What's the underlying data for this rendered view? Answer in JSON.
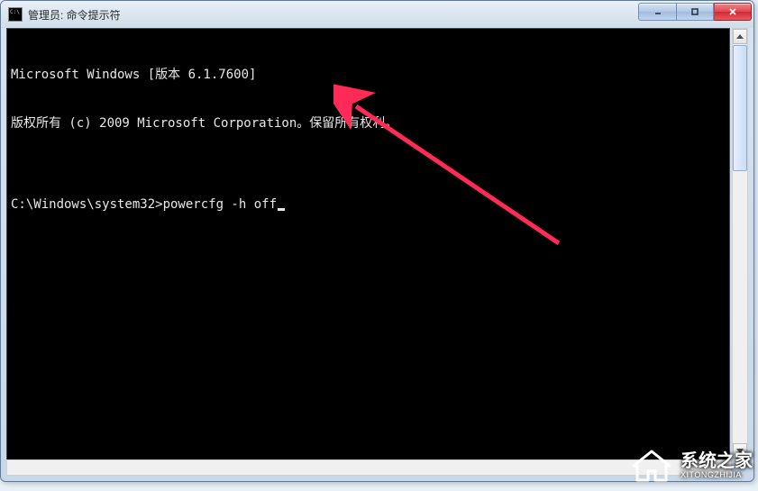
{
  "titlebar": {
    "title": "管理员: 命令提示符"
  },
  "console": {
    "line1": "Microsoft Windows [版本 6.1.7600]",
    "line2": "版权所有 (c) 2009 Microsoft Corporation。保留所有权利。",
    "blank": "",
    "prompt": "C:\\Windows\\system32>",
    "command": "powercfg -h off"
  },
  "watermark": {
    "main": "系统之家",
    "sub": "XITONGZHIJIA"
  }
}
